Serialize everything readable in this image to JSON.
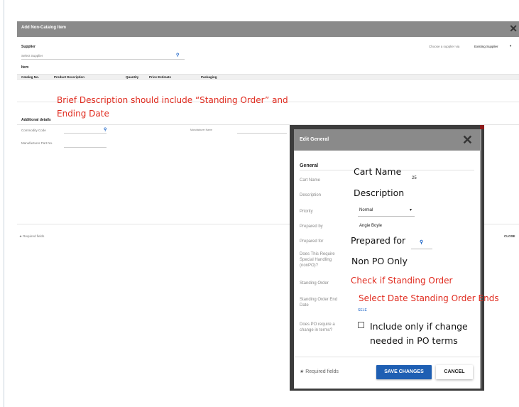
{
  "background_dialog": {
    "title": "Add Non-Catalog Item",
    "close_glyph": "✕",
    "supplier_label": "Supplier",
    "supplier_placeholder": "Select Supplier",
    "supplier_via_label": "Choose a supplier via",
    "supplier_via_value": "Existing Supplier",
    "item_label": "Item",
    "table_headers": [
      "Catalog No.",
      "Product Description",
      "Quantity",
      "Price Estimate",
      "Packaging"
    ],
    "additional_details_label": "Additional details",
    "commodity_code_label": "Commodity Code",
    "manufacturer_part_label": "Manufacturer Part No.",
    "manufacturer_name_label": "Manufacturer Name",
    "required_fields": "Required fields",
    "button_partial": "K",
    "close_button": "CLOSE"
  },
  "annotations": {
    "brief_line1": "Brief Description should include “Standing Order” and",
    "brief_line2": "Ending Date",
    "cart_name": "Cart Name",
    "description": "Description",
    "prepared_for": "Prepared for",
    "non_po_only": "Non PO Only",
    "check_standing": "Check if Standing Order",
    "select_date": "Select Date Standing Order Ends",
    "include_line1": "Include only if change",
    "include_line2": "needed in PO terms"
  },
  "edit_dialog": {
    "title": "Edit General",
    "close_glyph": "✕",
    "section": "General",
    "labels": {
      "cart_name": "Cart Name",
      "description": "Description",
      "priority": "Priority",
      "prepared_by": "Prepared by",
      "prepared_for": "Prepared for",
      "special_handling": "Does This Require Special Handling (nonPO)?",
      "standing_order": "Standing Order",
      "standing_order_end_date": "Standing Order End Date",
      "po_change_terms": "Does PO require a change in terms?"
    },
    "cart_name_value_fragment": "25",
    "priority_value": "Normal",
    "prepared_by_value": "Angie Boyle",
    "date_link": "SELE",
    "required_fields": "Required fields",
    "save_button": "SAVE CHANGES",
    "cancel_button": "CANCEL"
  },
  "colors": {
    "header_gray": "#8a8a8a",
    "annotation_red": "#e02b1f",
    "primary_blue": "#1e5fb3",
    "accent_maroon": "#8b1a1a"
  }
}
